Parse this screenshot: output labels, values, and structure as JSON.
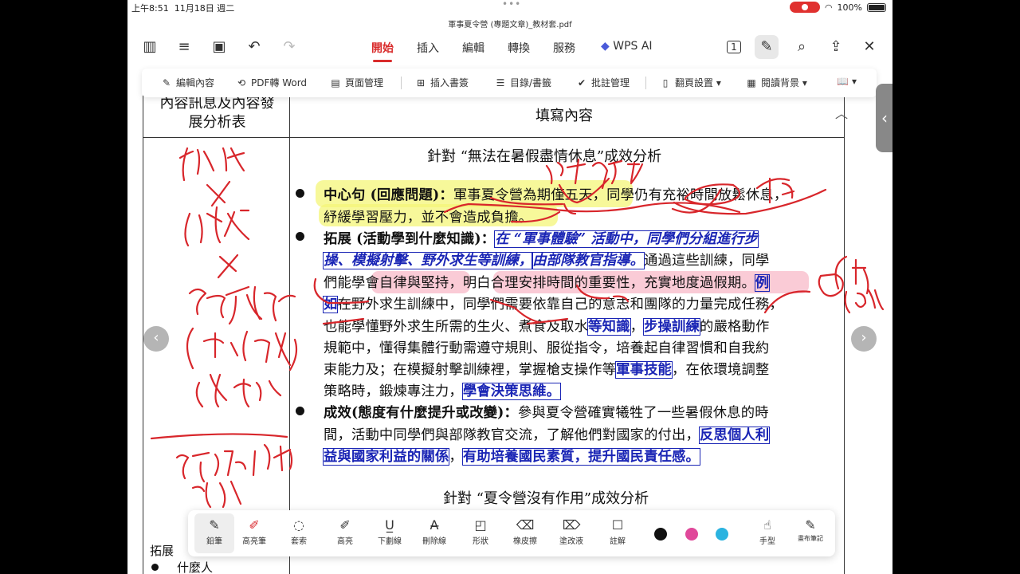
{
  "status": {
    "time": "上午8:51",
    "date": "11月18日 週二",
    "battery": "100%"
  },
  "doc_title": "軍事夏令營 (專題文章)_教材套.pdf",
  "tabs": [
    {
      "label": "開始"
    },
    {
      "label": "插入"
    },
    {
      "label": "編輯"
    },
    {
      "label": "轉換"
    },
    {
      "label": "服務"
    }
  ],
  "wps_ai": "WPS AI",
  "page_badge": "1",
  "ribbon": [
    {
      "label": "編輯內容"
    },
    {
      "label": "PDF轉 Word"
    },
    {
      "label": "頁面管理"
    },
    {
      "label": "插入書簽"
    },
    {
      "label": "目錄/書籤"
    },
    {
      "label": "批註管理"
    },
    {
      "label": "翻頁設置"
    },
    {
      "label": "閱讀背景"
    }
  ],
  "table": {
    "left_header": [
      "內容訊息及內容發",
      "展分析表"
    ],
    "right_header": "填寫內容",
    "section1_title": "針對 “無法在暑假盡情休息”成效分析",
    "b1": {
      "label": "中心句 (回應問題)：",
      "text1": "軍事夏令營為期僅五天，同學仍有充裕時間放鬆休息，",
      "text2": "紓緩學習壓力，並不會造成負擔。"
    },
    "b2": {
      "label": "拓展 (活動學到什麼知識)：",
      "blue1": "在 “軍事體驗” 活動中，同學們分組進行步",
      "blue2": "操、模擬射擊、野外求生等訓練，",
      "blue3": "由部隊教官指導。",
      "l2tail": "通過這些訓練，同學",
      "l3": "們能學會自律與堅持，明白合理安排時間的重要性，充實地度過假期。",
      "l3box": "例",
      "l4box": "如",
      "l4": "在野外求生訓練中，同學們需要依靠自己的意志和團隊的力量完成任務，",
      "l5a": "也能學懂野外求生所需的生火、煮食及取水",
      "l5b": "等知識",
      "l5c": "，",
      "l5d": "步操訓練",
      "l5e": "的嚴格動作",
      "l6": "規範中，懂得集體行動需遵守規則、服從指令，培養起自律習慣和自我約",
      "l7a": "束能力及；在模擬射擊訓練裡，掌握槍支操作等",
      "l7b": "軍事技能",
      "l7c": "，在依環境調整",
      "l8a": "策略時，鍛煉專注力，",
      "l8b": "學會決策思維。"
    },
    "b3": {
      "label": "成效(態度有什麼提升或改變)：",
      "text1": "參與夏令營確實犧牲了一些暑假休息的時",
      "l2a": "間，活動中同學們與部隊教官交流，了解他們對國家的付出，",
      "l2b": "反思個人利",
      "l3a": "益與國家利益的關係",
      "l3b": "，",
      "l3c": "有助培養國民素質，提升國民責任感。"
    },
    "section2_title": "針對 “夏令營沒有作用”成效分析",
    "bottom_left_label": "拓展",
    "bottom_left_item": "什麼人"
  },
  "pen_tools": [
    {
      "label": "鉛筆"
    },
    {
      "label": "高亮筆"
    },
    {
      "label": "套索"
    },
    {
      "label": "高亮"
    },
    {
      "label": "下劃線"
    },
    {
      "label": "刪除線"
    },
    {
      "label": "形狀"
    },
    {
      "label": "橡皮擦"
    },
    {
      "label": "塗改液"
    },
    {
      "label": "註解"
    },
    {
      "label": "手型"
    },
    {
      "label": "畫布筆記"
    }
  ],
  "pen_colors": [
    "#111111",
    "#e0489a",
    "#2bb3e0"
  ]
}
